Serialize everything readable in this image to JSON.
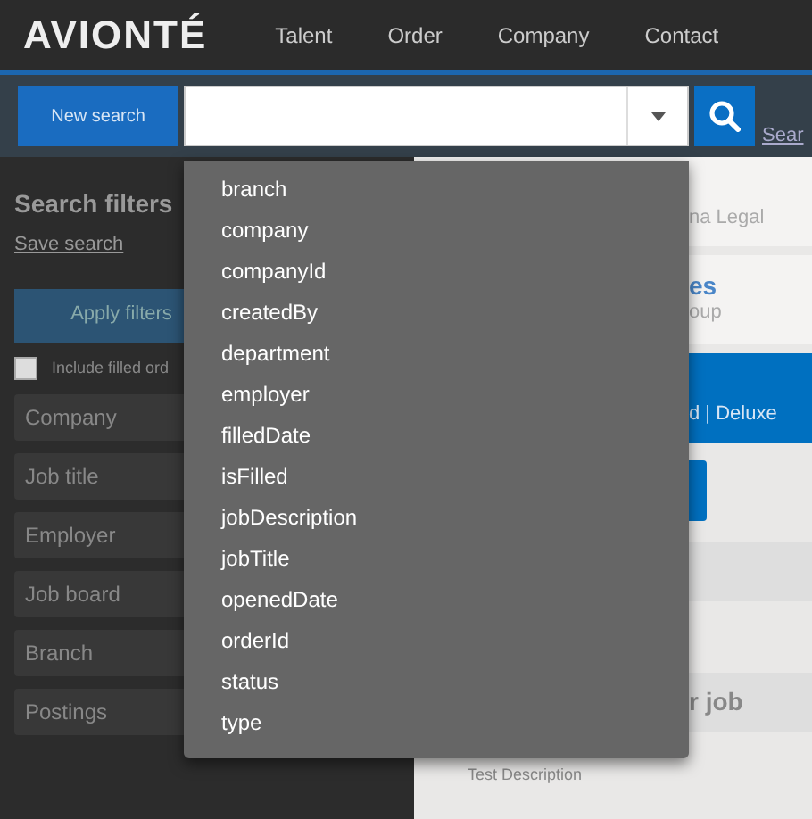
{
  "header": {
    "logo": "AVIONTÉ",
    "nav": [
      "Talent",
      "Order",
      "Company",
      "Contact"
    ]
  },
  "search_bar": {
    "new_search": "New search",
    "link": "Sear"
  },
  "dropdown": {
    "items": [
      "branch",
      "company",
      "companyId",
      "createdBy",
      "department",
      "employer",
      "filledDate",
      "isFilled",
      "jobDescription",
      "jobTitle",
      "openedDate",
      "orderId",
      "status",
      "type"
    ]
  },
  "sidebar": {
    "title": "Search filters",
    "save_link": "Save search",
    "apply": "Apply filters",
    "include_filled": {
      "label": "Include filled ord",
      "checked": false
    },
    "filters": [
      "Company",
      "Job title",
      "Employer",
      "Job board",
      "Branch",
      "Postings"
    ]
  },
  "content": {
    "card_1": {
      "line": "na Legal"
    },
    "card_2": {
      "title": "es",
      "line": "oup"
    },
    "banner": {
      "line": "d | Deluxe"
    },
    "section_title": "r job",
    "description": "Test Description"
  }
}
